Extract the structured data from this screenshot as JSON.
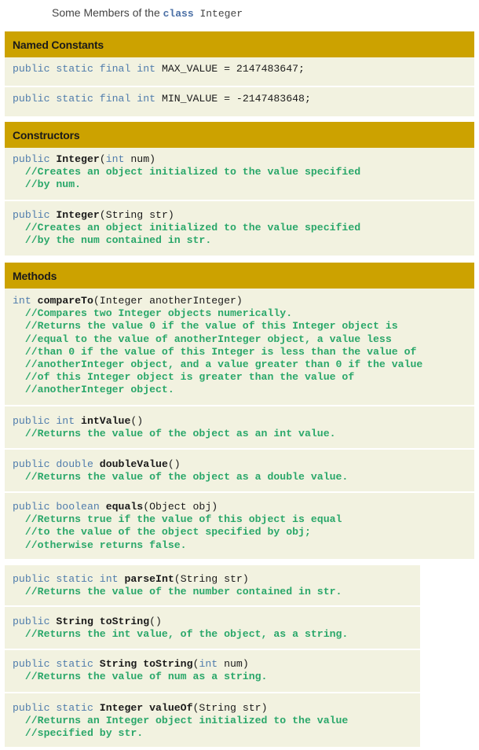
{
  "title": {
    "prefix": "Some Members of the ",
    "keyword": "class",
    "name": " Integer"
  },
  "sections": {
    "named_constants": "Named Constants",
    "constructors": "Constructors",
    "methods": "Methods"
  },
  "constants": [
    {
      "mods": "public static final int",
      "rest": " MAX_VALUE = 2147483647;"
    },
    {
      "mods": "public static final int",
      "rest": " MIN_VALUE = -2147483648;"
    }
  ],
  "constructors": [
    {
      "mods": "public",
      "name": " Integer",
      "open": "(",
      "ptype": "int",
      "rest": " num)",
      "comments": [
        "//Creates an object initialized to the value specified",
        "//by num."
      ]
    },
    {
      "mods": "public",
      "name": " Integer",
      "open": "(",
      "ptype": "",
      "rest": "String str)",
      "comments": [
        "//Creates an object initialized to the value specified",
        "//by the num contained in str."
      ]
    }
  ],
  "methods": [
    {
      "mods": "int",
      "name": " compareTo",
      "rest": "(Integer anotherInteger)",
      "comments": [
        "//Compares two Integer objects numerically.",
        "//Returns the value 0 if the value of this Integer object is",
        "//equal to the value of anotherInteger object, a value less",
        "//than 0 if the value of this Integer is less than the value of",
        "//anotherInteger object, and a value greater than 0 if the value",
        "//of this Integer object is greater than the value of",
        "//anotherInteger object."
      ]
    },
    {
      "mods": "public int",
      "name": " intValue",
      "rest": "()",
      "comments": [
        "//Returns the value of the object as an int value."
      ]
    },
    {
      "mods": "public double",
      "name": " doubleValue",
      "rest": "()",
      "comments": [
        "//Returns the value of the object as a double value."
      ]
    },
    {
      "mods": "public boolean",
      "name": " equals",
      "rest": "(Object obj)",
      "comments": [
        "//Returns true if the value of this object is equal",
        "//to the value of the object specified by obj;",
        "//otherwise returns false."
      ]
    },
    {
      "mods": "public static int",
      "name": " parseInt",
      "rest": "(String str)",
      "comments": [
        "//Returns the value of the number contained in str."
      ]
    },
    {
      "mods": "public",
      "name": " String toString",
      "rest": "()",
      "comments": [
        "//Returns the int value, of the object, as a string."
      ]
    },
    {
      "mods": "public static",
      "name": " String toString",
      "open": "(",
      "ptype": "int",
      "rest": " num)",
      "comments": [
        "//Returns the value of num as a string."
      ]
    },
    {
      "mods": "public static",
      "name": " Integer valueOf",
      "rest": "(String str)",
      "comments": [
        "//Returns an Integer object initialized to the value",
        "//specified by str."
      ]
    }
  ]
}
